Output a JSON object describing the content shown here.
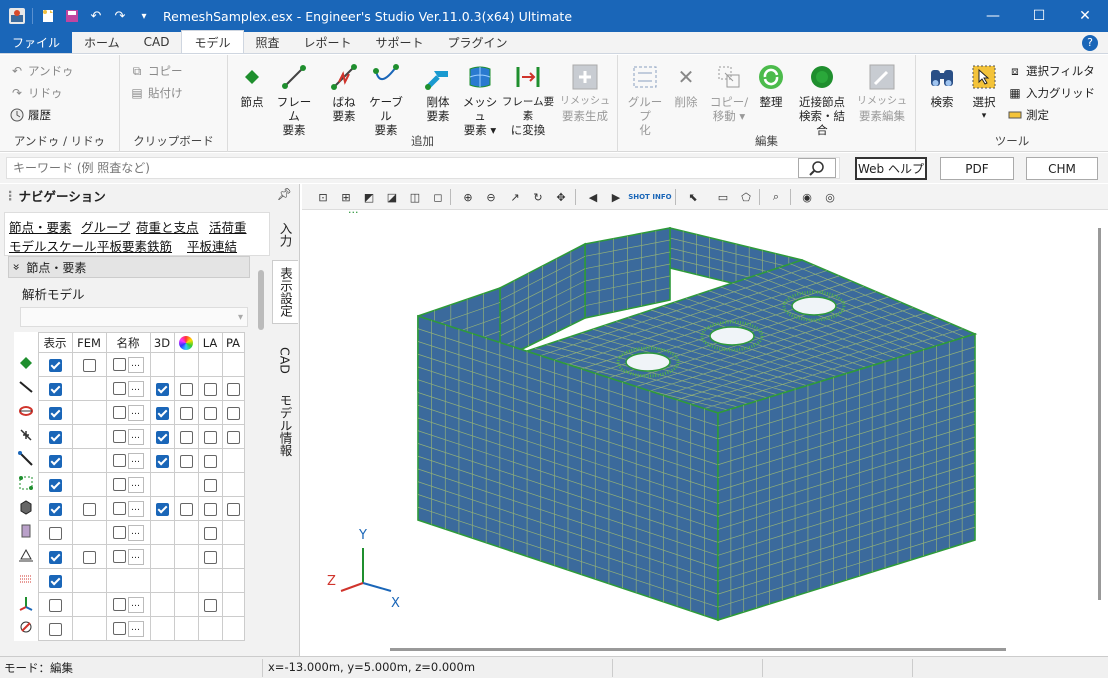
{
  "window": {
    "title": "RemeshSamplex.esx - Engineer's Studio Ver.11.0.3(x64) Ultimate",
    "controls": {
      "minimize": "—",
      "maximize": "☐",
      "close": "✕"
    }
  },
  "tabs": [
    {
      "label": "ファイル"
    },
    {
      "label": "ホーム"
    },
    {
      "label": "CAD"
    },
    {
      "label": "モデル"
    },
    {
      "label": "照査"
    },
    {
      "label": "レポート"
    },
    {
      "label": "サポート"
    },
    {
      "label": "プラグイン"
    }
  ],
  "active_tab": "モデル",
  "ribbon": {
    "undo_group": {
      "label": "アンドゥ / リドゥ",
      "undo": "アンドゥ",
      "redo": "リドゥ",
      "history": "履歴"
    },
    "clipboard_group": {
      "label": "クリップボード",
      "copy": "コピー",
      "paste": "貼付け"
    },
    "add_group": {
      "label": "追加",
      "buttons": [
        {
          "l1": "節点",
          "l2": ""
        },
        {
          "l1": "フレーム",
          "l2": "要素"
        },
        {
          "l1": "ばね",
          "l2": "要素"
        },
        {
          "l1": "ケーブル",
          "l2": "要素"
        },
        {
          "l1": "剛体",
          "l2": "要素"
        },
        {
          "l1": "メッシュ",
          "l2": "要素 ▾"
        },
        {
          "l1": "フレーム要素",
          "l2": "に変換"
        },
        {
          "l1": "リメッシュ",
          "l2": "要素生成"
        }
      ]
    },
    "edit_group": {
      "label": "編集",
      "buttons": [
        {
          "l1": "グループ",
          "l2": "化"
        },
        {
          "l1": "削除",
          "l2": ""
        },
        {
          "l1": "コピー/",
          "l2": "移動 ▾"
        },
        {
          "l1": "整理",
          "l2": ""
        },
        {
          "l1": "近接節点",
          "l2": "検索・結合"
        },
        {
          "l1": "リメッシュ",
          "l2": "要素編集"
        }
      ]
    },
    "tools_group": {
      "label": "ツール",
      "search": "検索",
      "select": "選択",
      "select_arrow": "▾",
      "select_filter": "選択フィルタ",
      "input_grid": "入力グリッド",
      "measure": "測定"
    }
  },
  "search": {
    "placeholder": "キーワード (例 照査など)",
    "web_help": "Web ヘルプ",
    "pdf": "PDF",
    "chm": "CHM"
  },
  "navigation": {
    "title": "ナビゲーション",
    "links": [
      "節点・要素",
      "グループ",
      "荷重と支点",
      "活荷重",
      "モデルスケール",
      "平板要素鉄筋",
      "平板連結"
    ],
    "side_tabs": [
      "入力",
      "表示設定",
      "CAD",
      "モデル情報"
    ],
    "section": "節点・要素",
    "section_chevron": "»",
    "model_label": "解析モデル",
    "select_arrow": "▾",
    "columns": [
      "表示",
      "FEM",
      "名称",
      "3D",
      "",
      "LA",
      "PA"
    ],
    "dots_label": "…",
    "rows": [
      {
        "icon": "node-icon",
        "show": true,
        "fem": "cb",
        "name": "cbdots",
        "d3": "",
        "color": "",
        "la": "",
        "pa": ""
      },
      {
        "icon": "frame-icon",
        "show": true,
        "fem": "",
        "name": "cbdots",
        "d3": "on",
        "color": "cb",
        "la": "cb",
        "pa": "cb"
      },
      {
        "icon": "spring-icon",
        "show": true,
        "fem": "",
        "name": "cbdots",
        "d3": "on",
        "color": "cb",
        "la": "cb",
        "pa": "cb"
      },
      {
        "icon": "cable-icon",
        "show": true,
        "fem": "",
        "name": "cbdots",
        "d3": "on",
        "color": "cb",
        "la": "cb",
        "pa": "cb"
      },
      {
        "icon": "rigid-icon",
        "show": true,
        "fem": "",
        "name": "cbdots",
        "d3": "on",
        "color": "cb",
        "la": "cb",
        "pa": ""
      },
      {
        "icon": "link-icon",
        "show": true,
        "fem": "",
        "name": "cbdots",
        "d3": "",
        "color": "",
        "la": "cb",
        "pa": ""
      },
      {
        "icon": "solid-icon",
        "show": true,
        "fem": "cb",
        "name": "cbdots",
        "d3": "on",
        "color": "cb",
        "la": "cb",
        "pa": "cb"
      },
      {
        "icon": "layer-icon",
        "show": false,
        "fem": "",
        "name": "cbdots",
        "d3": "",
        "color": "",
        "la": "cb",
        "pa": ""
      },
      {
        "icon": "support-icon",
        "show": true,
        "fem": "cb",
        "name": "cbdots",
        "d3": "",
        "color": "",
        "la": "cb",
        "pa": ""
      },
      {
        "icon": "ground-icon",
        "show": true,
        "fem": "",
        "name": "",
        "d3": "",
        "color": "",
        "la": "",
        "pa": ""
      },
      {
        "icon": "axis-icon",
        "show": false,
        "fem": "",
        "name": "cbdots",
        "d3": "",
        "color": "",
        "la": "cb",
        "pa": ""
      },
      {
        "icon": "pin-icon",
        "show": false,
        "fem": "",
        "name": "cbdots",
        "d3": "",
        "color": "",
        "la": "",
        "pa": ""
      }
    ]
  },
  "viewport": {
    "axes": {
      "x": "X",
      "y": "Y",
      "z": "Z"
    },
    "toolbar_labels": {
      "shot": "SHOT",
      "info": "INFO"
    },
    "indicator": "···"
  },
  "status": {
    "mode": "モード：編集",
    "coords": "x=-13.000m, y=5.000m, z=0.000m"
  },
  "colors": {
    "accent": "#1a66b8",
    "mesh_face": "#3b6a9c",
    "mesh_edge": "#2e9a3a"
  }
}
